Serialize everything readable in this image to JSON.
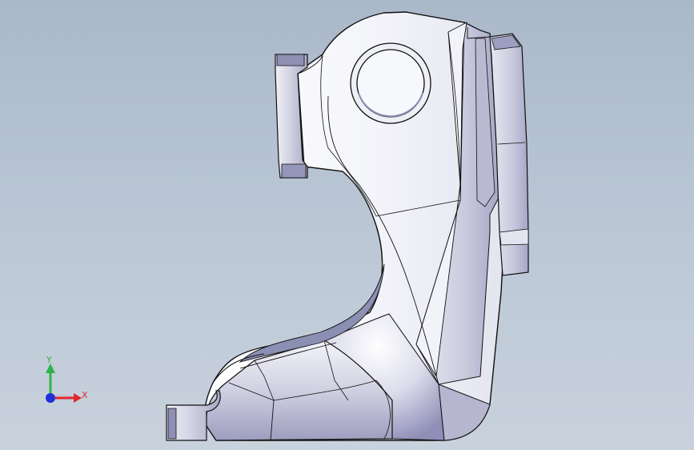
{
  "viewport": {
    "background": [
      "#aab8c9",
      "#c8d2dd"
    ],
    "part_colors": {
      "face_light": "#f4f5fa",
      "face_mid": "#dcdcea",
      "face_dark": "#9c9cc0",
      "edge": "#111111"
    }
  },
  "triad": {
    "y_label": "Y",
    "x_label": "X",
    "y_color": "#2bb34a",
    "x_color": "#e0262d",
    "z_color": "#1f2fd8"
  }
}
